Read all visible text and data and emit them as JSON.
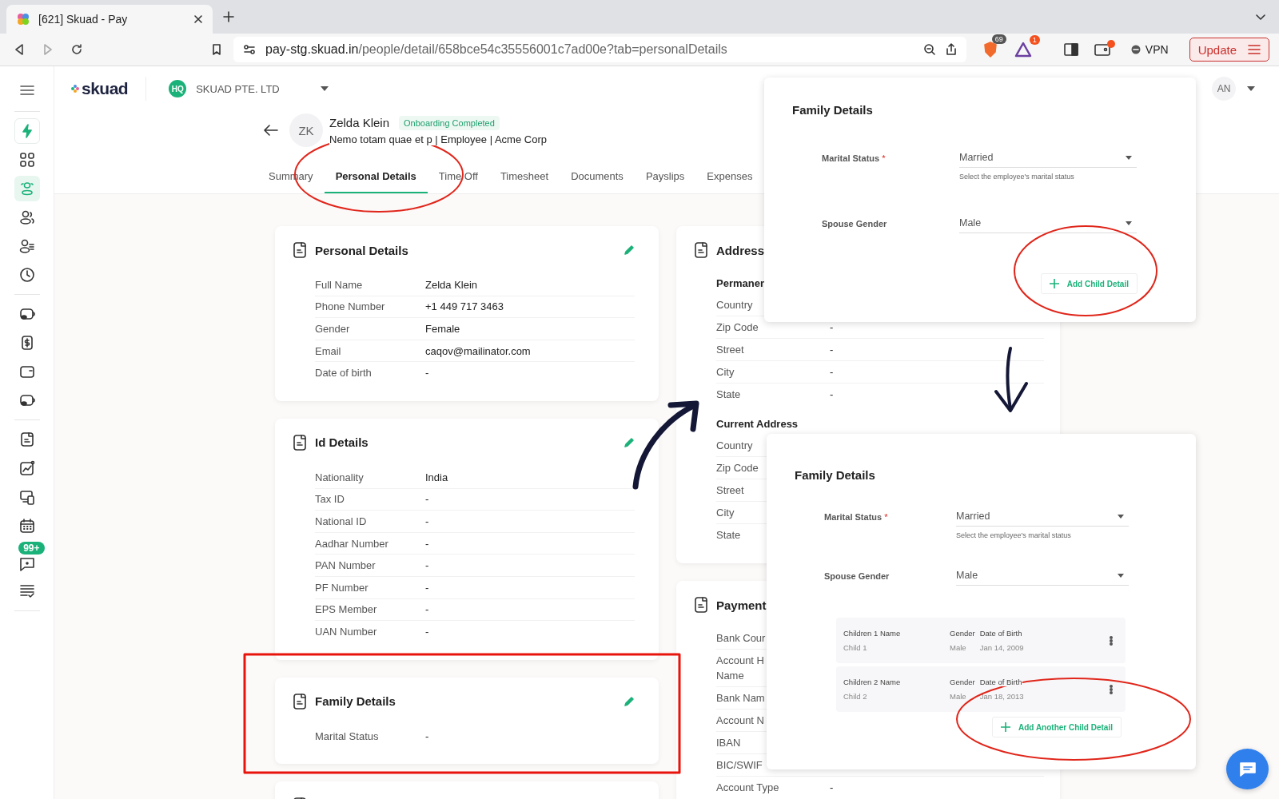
{
  "browser": {
    "tab_title": "[621] Skuad - Pay",
    "url_host": "pay-stg.skuad.in",
    "url_path": "/people/detail/658bce54c35556001c7ad00e?tab=personalDetails",
    "shields_count": "69",
    "alert_count": "1",
    "vpn": "VPN",
    "update": "Update"
  },
  "header": {
    "logo": "skuad",
    "company_badge": "HQ",
    "company": "SKUAD PTE. LTD",
    "user": "AN"
  },
  "sidebar": {
    "groups": [
      [
        {
          "selected": false
        },
        {
          "selected": false
        },
        {
          "selected": true
        },
        {
          "selected": false
        },
        {
          "selected": false
        },
        {
          "selected": false
        }
      ],
      [
        {
          "selected": false
        },
        {
          "selected": false
        },
        {
          "selected": false
        },
        {
          "selected": false
        }
      ],
      [
        {
          "selected": false
        },
        {
          "selected": false
        },
        {
          "selected": false
        },
        {
          "selected": false
        },
        {
          "selected": false,
          "badge": "99+"
        },
        {
          "selected": false
        }
      ]
    ]
  },
  "profile": {
    "initials": "ZK",
    "name": "Zelda Klein",
    "status": "Onboarding Completed",
    "subtitle": "Nemo totam quae et p | Employee | Acme Corp"
  },
  "tabs": [
    {
      "label": "Summary",
      "selected": false
    },
    {
      "label": "Personal Details",
      "selected": true
    },
    {
      "label": "Time Off",
      "selected": false
    },
    {
      "label": "Timesheet",
      "selected": false
    },
    {
      "label": "Documents",
      "selected": false
    },
    {
      "label": "Payslips",
      "selected": false
    },
    {
      "label": "Expenses",
      "selected": false
    }
  ],
  "left_cards": [
    {
      "title": "Personal Details",
      "rows": [
        {
          "label": "Full Name",
          "value": "Zelda Klein"
        },
        {
          "label": "Phone Number",
          "value": "+1 449 717 3463"
        },
        {
          "label": "Gender",
          "value": "Female"
        },
        {
          "label": "Email",
          "value": "caqov@mailinator.com"
        },
        {
          "label": "Date of birth",
          "value": "-"
        }
      ]
    },
    {
      "title": "Id Details",
      "rows": [
        {
          "label": "Nationality",
          "value": "India"
        },
        {
          "label": "Tax ID",
          "value": "-"
        },
        {
          "label": "National ID",
          "value": "-"
        },
        {
          "label": "Aadhar Number",
          "value": "-"
        },
        {
          "label": "PAN Number",
          "value": "-"
        },
        {
          "label": "PF Number",
          "value": "-"
        },
        {
          "label": "EPS Member",
          "value": "-"
        },
        {
          "label": "UAN Number",
          "value": "-"
        }
      ]
    },
    {
      "title": "Family Details",
      "rows": [
        {
          "label": "Marital Status",
          "value": "-"
        }
      ]
    }
  ],
  "right_cards": [
    {
      "title": "Address",
      "sections": [
        {
          "heading": "Permanen",
          "rows": [
            {
              "label": "Country"
            },
            {
              "label": "Zip Code",
              "value": "-"
            },
            {
              "label": "Street",
              "value": "-"
            },
            {
              "label": "City",
              "value": "-"
            },
            {
              "label": "State",
              "value": "-"
            }
          ]
        },
        {
          "heading": "Current Address",
          "rows": [
            {
              "label": "Country"
            },
            {
              "label": "Zip Code"
            },
            {
              "label": "Street"
            },
            {
              "label": "City"
            },
            {
              "label": "State"
            }
          ]
        }
      ]
    },
    {
      "title": "Payment",
      "sections": [
        {
          "rows": [
            {
              "label": "Bank Cour"
            },
            {
              "label": "Account H\nName"
            },
            {
              "label": "Bank Nam"
            },
            {
              "label": "Account N"
            },
            {
              "label": "IBAN"
            },
            {
              "label": "BIC/SWIF"
            },
            {
              "label": "Account Type",
              "value": "-"
            }
          ]
        }
      ]
    }
  ],
  "overlays": [
    {
      "title": "Family Details",
      "fields": [
        {
          "label": "Marital Status",
          "required_mark": "*",
          "value": "Married",
          "helper": "Select the employee's marital status"
        },
        {
          "label": "Spouse Gender",
          "value": "Male"
        }
      ],
      "button": "Add Child Detail"
    },
    {
      "title": "Family Details",
      "fields": [
        {
          "label": "Marital Status",
          "required_mark": "*",
          "value": "Married",
          "helper": "Select the employee's marital status"
        },
        {
          "label": "Spouse Gender",
          "value": "Male"
        }
      ],
      "children": [
        {
          "name_label": "Children 1 Name",
          "name": "Child 1",
          "gender_label": "Gender",
          "gender": "Male",
          "dob_label": "Date of Birth",
          "dob": "Jan 14, 2009"
        },
        {
          "name_label": "Children 2 Name",
          "name": "Child 2",
          "gender_label": "Gender",
          "gender": "Male",
          "dob_label": "Date of Birth",
          "dob": "Jan 18, 2013"
        }
      ],
      "button": "Add Another Child Detail"
    }
  ]
}
